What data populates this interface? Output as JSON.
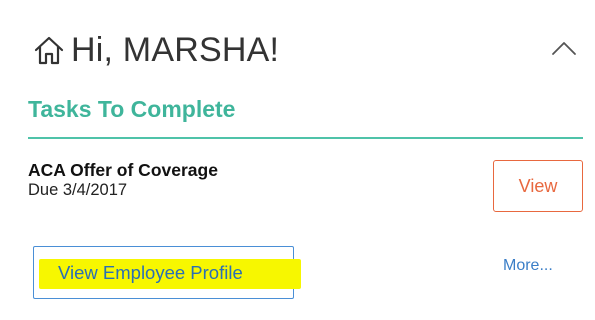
{
  "header": {
    "home_icon": "home-icon",
    "greeting": "Hi, MARSHA!",
    "collapse_icon": "chevron-up-icon"
  },
  "tasks": {
    "title": "Tasks To Complete",
    "items": [
      {
        "name": "ACA Offer of Coverage",
        "due": "Due 3/4/2017",
        "action_label": "View"
      }
    ]
  },
  "footer": {
    "profile_button_label": "View Employee Profile",
    "more_link_label": "More..."
  },
  "colors": {
    "accent": "#3fb59b",
    "action": "#e8683f",
    "link": "#3a7ec7",
    "highlight": "#f7f700"
  }
}
